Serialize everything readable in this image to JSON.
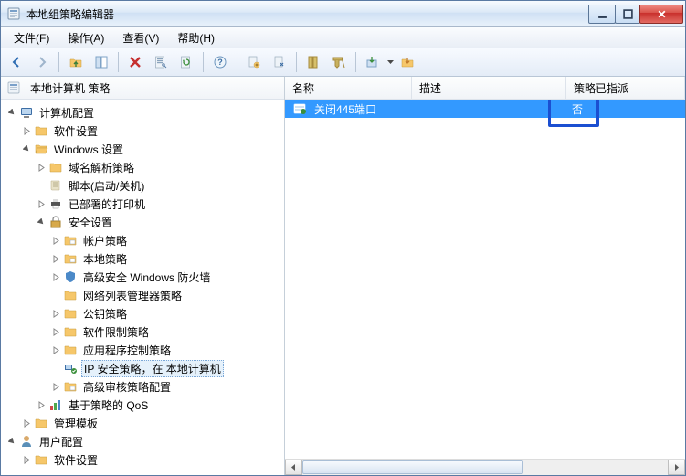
{
  "window": {
    "title": "本地组策略编辑器"
  },
  "menus": {
    "file": "文件(F)",
    "action": "操作(A)",
    "view": "查看(V)",
    "help": "帮助(H)"
  },
  "treeheader": {
    "label": "本地计算机 策略"
  },
  "tree": {
    "root": "本地计算机 策略",
    "n1": "计算机配置",
    "n1_1": "软件设置",
    "n1_2": "Windows 设置",
    "n1_2_1": "域名解析策略",
    "n1_2_2": "脚本(启动/关机)",
    "n1_2_3": "已部署的打印机",
    "n1_2_4": "安全设置",
    "n1_2_4_1": "帐户策略",
    "n1_2_4_2": "本地策略",
    "n1_2_4_3": "高级安全 Windows 防火墙",
    "n1_2_4_4": "网络列表管理器策略",
    "n1_2_4_5": "公钥策略",
    "n1_2_4_6": "软件限制策略",
    "n1_2_4_7": "应用程序控制策略",
    "n1_2_4_8": "IP 安全策略，在 本地计算机",
    "n1_2_4_9": "高级审核策略配置",
    "n1_2_5": "基于策略的 QoS",
    "n1_3": "管理模板",
    "n2": "用户配置",
    "n2_1": "软件设置"
  },
  "columns": {
    "name": "名称",
    "desc": "描述",
    "assigned": "策略已指派"
  },
  "rows": [
    {
      "name": "关闭445端口",
      "desc": "",
      "assigned": "否"
    }
  ],
  "colwidths": {
    "name": 130,
    "desc": 160,
    "assigned": 130
  }
}
